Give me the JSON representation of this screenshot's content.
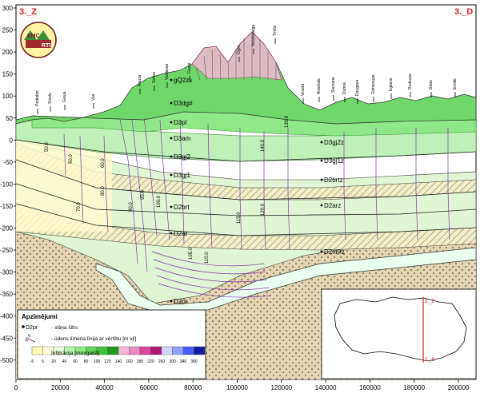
{
  "corners": {
    "left": "3._Z",
    "right": "3._D"
  },
  "logo": {
    "text_top": "EMC",
    "text_right": "RTU"
  },
  "y_axis_ticks": [
    "300",
    "250",
    "200",
    "150",
    "100",
    "50",
    "0",
    "-50",
    "-100",
    "-150",
    "-200",
    "-250",
    "-300",
    "-350",
    "-400",
    "-450",
    "-500"
  ],
  "x_axis_ticks": [
    "0",
    "20000",
    "40000",
    "60000",
    "80000",
    "100000",
    "120000",
    "140000",
    "160000",
    "180000",
    "200000"
  ],
  "places": [
    "Pededze",
    "Sinole",
    "Gaujа",
    "Vija",
    "Rauza",
    "Sedas",
    "Vaidavas",
    "Gauja",
    "Ogre",
    "Vecpiebalga",
    "Tirelis",
    "Veseta",
    "Aiviekste",
    "Sierzane",
    "Dubna",
    "Daugava",
    "Zalmesupe",
    "Eglaine",
    "Rudzupe",
    "Dobe",
    "Emilte"
  ],
  "layers": [
    "gQ2zs",
    "D3dg#",
    "D3pl",
    "D3am",
    "D3gj2",
    "D3gj1",
    "D2brt",
    "D2ar",
    "D3gj2z",
    "D3gj1z",
    "D2brtz",
    "D2arz",
    "D2nr#z",
    "D2pr"
  ],
  "iso_values": [
    "50.0",
    "60.0",
    "70.0",
    "80.0",
    "90.0",
    "95.0",
    "100.0",
    "105.0",
    "110.0",
    "115.0",
    "120.0",
    "130.0",
    "140.0"
  ],
  "legend": {
    "title": "Apzīmējumi",
    "symbol_code": "D2pr",
    "symbol_text": "- slāņa šifrs",
    "line_sample": "95.0",
    "line_text": "- ūdens līmeņa līnija ar vērtību [m vjl]",
    "unit_label": "Infiltrācija [mm/gadā]",
    "colorbar_ticks": [
      "-5",
      "5",
      "20",
      "40",
      "60",
      "80",
      "100",
      "120",
      "140",
      "160",
      "180",
      "220",
      "260",
      "300",
      "340",
      "380"
    ],
    "colors": [
      "#fff7b3",
      "#fffbd6",
      "#e8ffdc",
      "#b4f5b0",
      "#8fe887",
      "#5fd45a",
      "#3fc23a",
      "#1c9a1a",
      "#f5b7d6",
      "#e88ac0",
      "#d9459a",
      "#b1166f",
      "#cfd3ff",
      "#8fa0ff",
      "#4a5bff",
      "#131a9c"
    ]
  },
  "map": {
    "top_label": "3._Z",
    "bottom_label": "3._D"
  }
}
